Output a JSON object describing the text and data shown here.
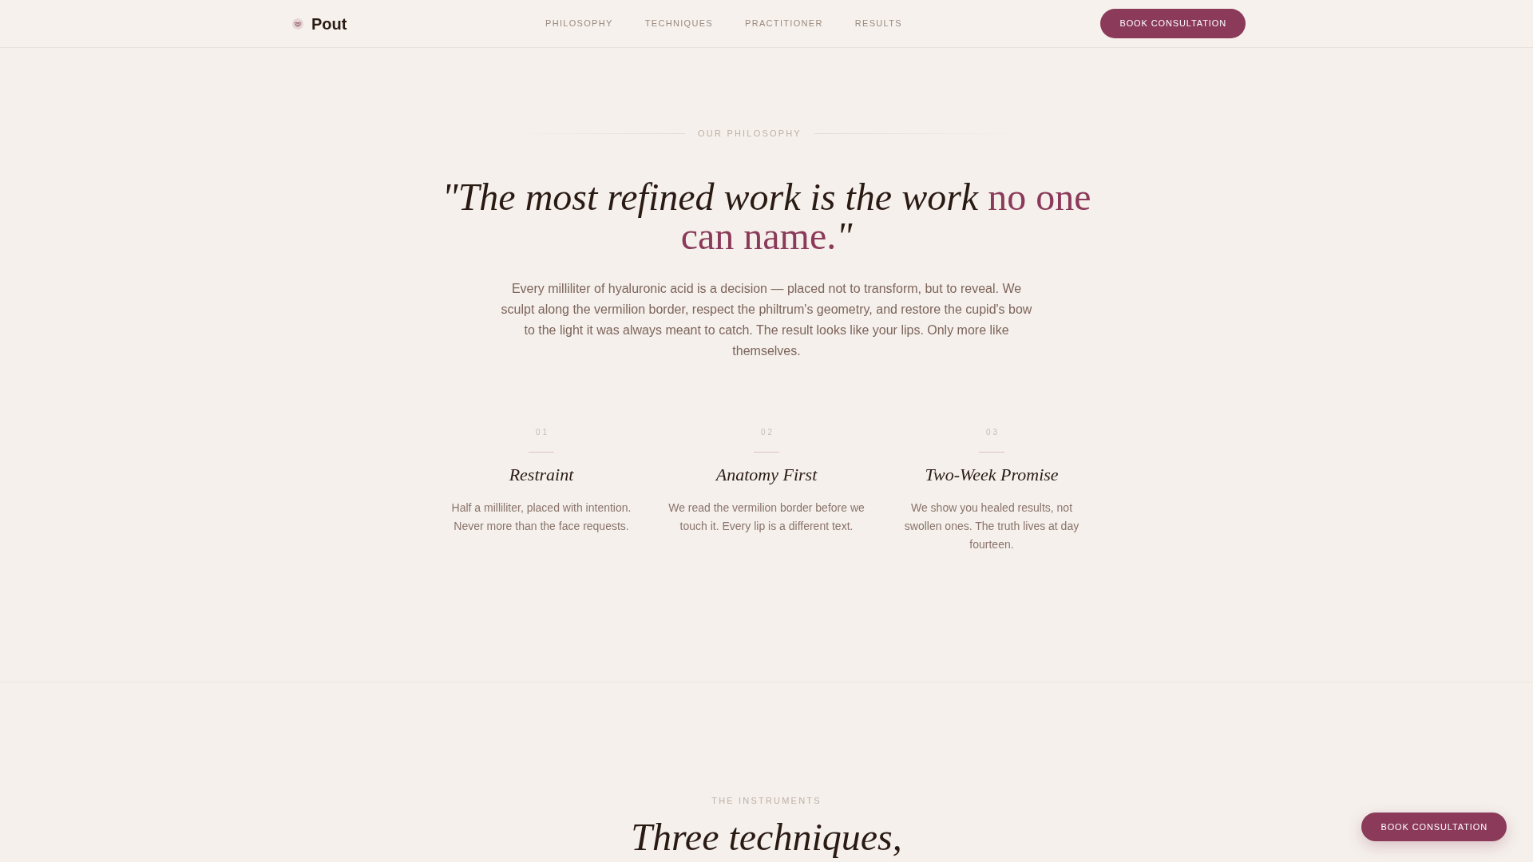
{
  "nav": {
    "brand": "Pout",
    "links": [
      "PHILOSOPHY",
      "TECHNIQUES",
      "PRACTITIONER",
      "RESULTS"
    ],
    "cta": "BOOK CONSULTATION"
  },
  "philosophy": {
    "eyebrow": "OUR PHILOSOPHY",
    "headline": [
      {
        "kind": "plain",
        "text": "\"The most refined work is the work "
      },
      {
        "kind": "accent",
        "text": "no one can name."
      },
      {
        "kind": "plain",
        "text": "\""
      }
    ],
    "body": "Every milliliter of hyaluronic acid is a decision — placed not to transform, but to reveal. We sculpt along the vermilion border, respect the philtrum's geometry, and restore the cupid's bow to the light it was always meant to catch. The result looks like your lips. Only more like themselves.",
    "principles": [
      {
        "number": "01",
        "title": "Restraint",
        "text": "Half a milliliter, placed with intention. Never more than the face requests."
      },
      {
        "number": "02",
        "title": "Anatomy First",
        "text": "We read the vermilion border before we touch it. Every lip is a different text."
      },
      {
        "number": "03",
        "title": "Two-Week Promise",
        "text": "We show you healed results, not swollen ones. The truth lives at day fourteen."
      }
    ]
  },
  "instruments": {
    "eyebrow": "THE INSTRUMENTS",
    "headline": "Three techniques,"
  },
  "floating_button": "BOOK CONSULTATION"
}
